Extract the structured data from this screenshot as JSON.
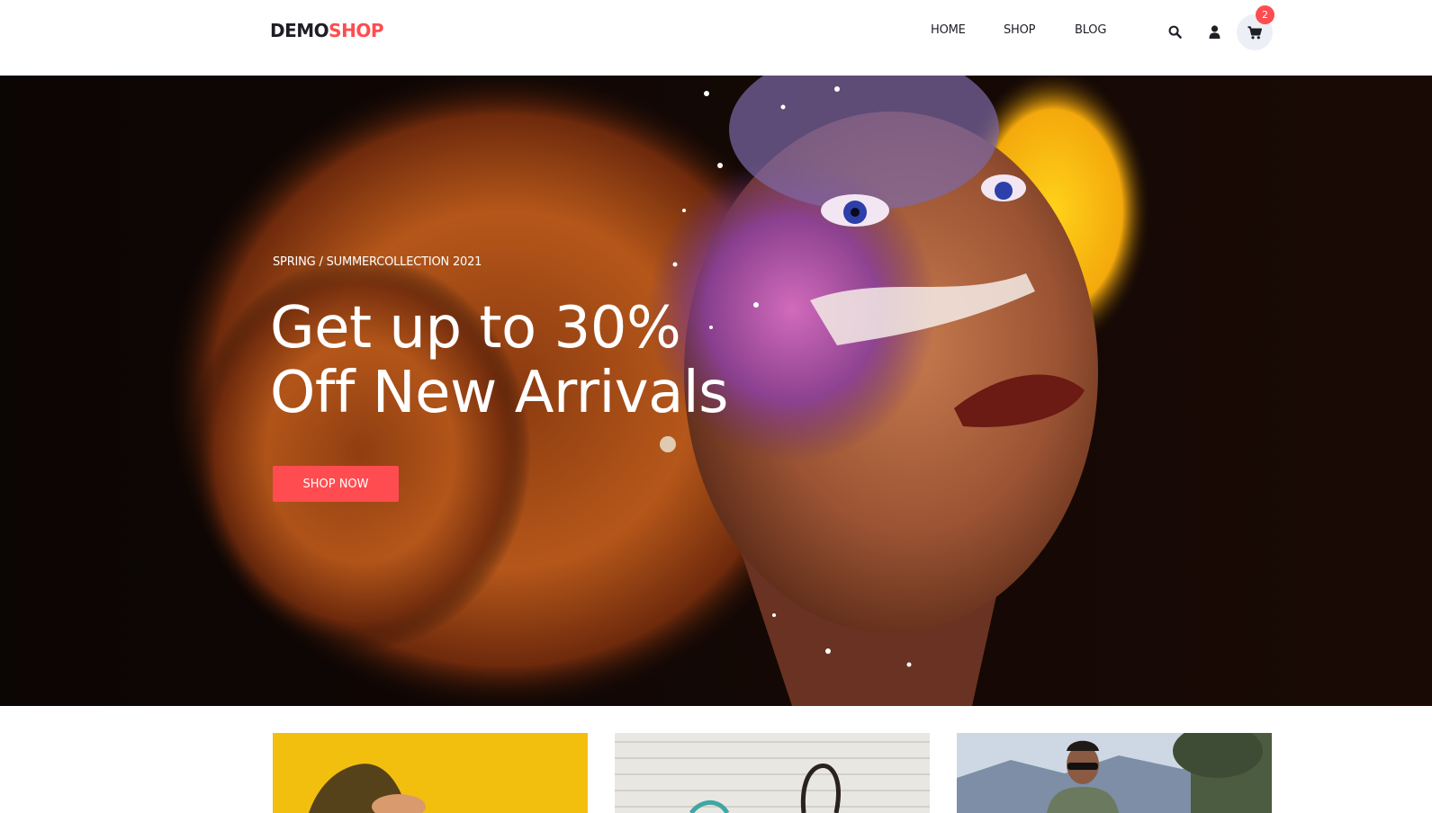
{
  "brand": {
    "logo_dark": "DEMO",
    "logo_accent": "SHOP",
    "accent_color": "#fe4c50",
    "text_color": "#1e1e27"
  },
  "nav": {
    "items": [
      {
        "label": "HOME"
      },
      {
        "label": "SHOP"
      },
      {
        "label": "BLOG"
      }
    ]
  },
  "header_icons": {
    "search": "search-icon",
    "account": "user-icon",
    "cart": "cart-icon",
    "cart_count": "2"
  },
  "hero": {
    "subtitle": "SPRING / SUMMERCOLLECTION 2021",
    "title_line1": "Get up to 30%",
    "title_line2": "Off New Arrivals",
    "cta_label": "SHOP NOW"
  },
  "banners": [
    {
      "theme": "yellow"
    },
    {
      "theme": "light-wood"
    },
    {
      "theme": "outdoor-sky"
    }
  ]
}
